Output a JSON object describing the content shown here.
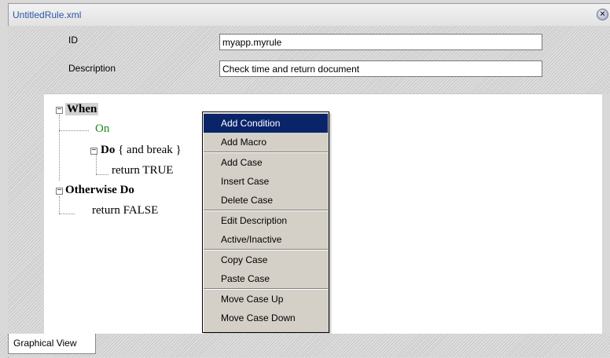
{
  "window": {
    "title": "UntitledRule.xml",
    "close_icon": "close-icon"
  },
  "form": {
    "id_label": "ID",
    "id_value": "myapp.myrule",
    "description_label": "Description",
    "description_value": "Check time and return document"
  },
  "tree": {
    "when_label": "When",
    "on_label": "On",
    "do_label": "Do",
    "do_suffix": " { and break }",
    "return_true": "return TRUE",
    "otherwise_label": "Otherwise Do",
    "return_false": "return FALSE",
    "toggle_symbol": "−"
  },
  "context_menu": {
    "items": [
      "Add Condition",
      "Add Macro",
      "Add Case",
      "Insert Case",
      "Delete Case",
      "Edit Description",
      "Active/Inactive",
      "Copy Case",
      "Paste Case",
      "Move Case Up",
      "Move Case Down"
    ],
    "highlighted_index": 0
  },
  "tabs": {
    "graphical_view": "Graphical View"
  },
  "colors": {
    "title_text": "#2a56a8",
    "on_text": "#1a8a1a",
    "menu_highlight": "#0a246a",
    "menu_background": "#d4d0c8"
  }
}
